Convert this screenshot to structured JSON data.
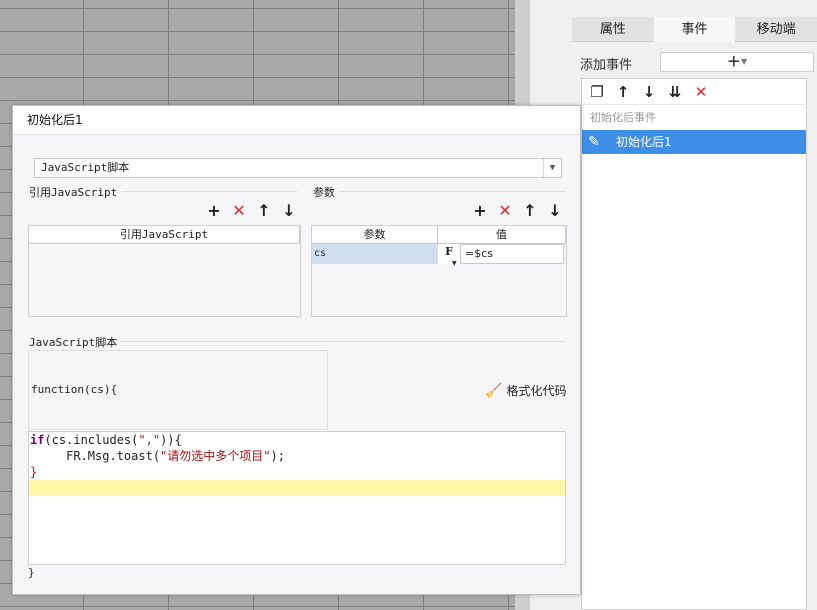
{
  "panel": {
    "tabs": [
      {
        "label": "属性"
      },
      {
        "label": "事件"
      },
      {
        "label": "移动端"
      }
    ],
    "add_event_label": "添加事件",
    "add_event_button": "+",
    "toolbar_icons": [
      "copy-icon",
      "arrow-up-icon",
      "arrow-down-icon",
      "move-bottom-icon",
      "delete-icon"
    ],
    "event_group": "初始化后事件",
    "event_item": "初始化后1"
  },
  "dialog": {
    "title": "初始化后1",
    "type_select_value": "JavaScript脚本",
    "ref_js": {
      "section_label": "引用JavaScript",
      "column_header": "引用JavaScript"
    },
    "params": {
      "section_label": "参数",
      "columns": [
        "参数",
        "值"
      ],
      "rows": [
        {
          "name": "cs",
          "formula_button": "F",
          "value": "=$cs"
        }
      ]
    },
    "script": {
      "section_label": "JavaScript脚本",
      "function_header": "function(cs){",
      "format_button": "格式化代码",
      "code_lines": [
        {
          "parts": [
            {
              "t": "if",
              "c": "kw"
            },
            {
              "t": "(cs.includes(",
              "c": "normal"
            },
            {
              "t": "\",\"",
              "c": "str"
            },
            {
              "t": ")){",
              "c": "normal"
            }
          ]
        },
        {
          "parts": [
            {
              "t": "     FR.Msg.toast(",
              "c": "normal"
            },
            {
              "t": "\"请勿选中多个项目\"",
              "c": "str"
            },
            {
              "t": ");",
              "c": "normal"
            }
          ]
        },
        {
          "parts": [
            {
              "t": "}",
              "c": "bad"
            }
          ]
        },
        {
          "parts": [
            {
              "t": " ",
              "c": "normal"
            }
          ],
          "active": true
        }
      ],
      "function_footer": "}"
    }
  }
}
